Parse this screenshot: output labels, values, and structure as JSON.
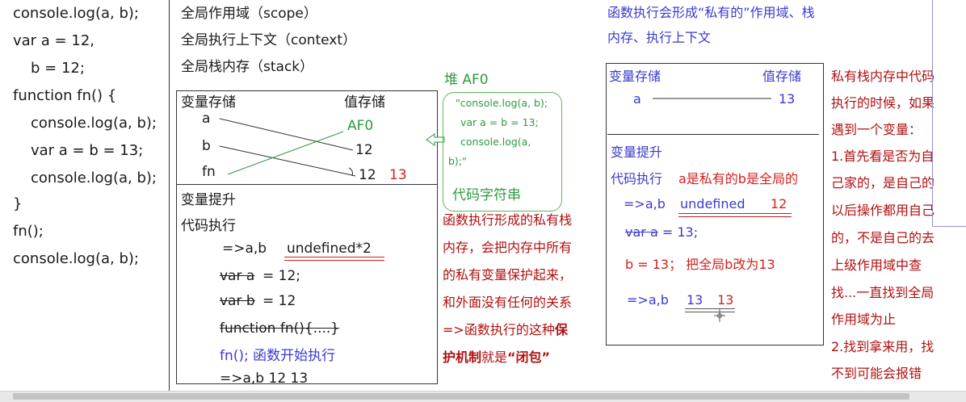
{
  "code": {
    "lines": [
      "console.log(a, b);",
      "var a = 12,",
      "b = 12;",
      "function fn() {",
      "console.log(a, b);",
      "var a = b = 13;",
      "console.log(a, b);",
      "}",
      "fn();",
      "console.log(a, b);"
    ]
  },
  "global": {
    "scope": "全局作用域（scope）",
    "context": "全局执行上下文（context）",
    "stack": "全局栈内存（stack）"
  },
  "global_box": {
    "var_store": "变量存储",
    "val_store": "值存储",
    "var_a": "a",
    "var_b": "b",
    "var_fn": "fn",
    "af0": "AF0",
    "val_12a": "12",
    "val_12b": "12",
    "val_13": "13",
    "hoist": "变量提升",
    "exec": "代码执行",
    "line1_arrow": "=>a,b",
    "line1_val": "undefined*2",
    "line2_kw": "var a",
    "line2_rest": "= 12;",
    "line3_kw": "var b",
    "line3_rest": "= 12",
    "line4": "function fn(){....}",
    "line5": "fn();  函数开始执行",
    "line6": "=>a,b   12  13"
  },
  "heap": {
    "title": "堆 AF0",
    "l1": "\"console.log(a, b);",
    "l2": "var a = b = 13;",
    "l3": "console.log(a,",
    "l4": "b);\"",
    "label": "代码字符串"
  },
  "closure": {
    "l1": "函数执行形成的私有栈",
    "l2": "内存，会把内存中所有",
    "l3": "的私有变量保护起来，",
    "l4": "和外面没有任何的关系",
    "l5_pre": "=>函数执行的这种",
    "l5_bold": "保",
    "l6_bold1": "护机制",
    "l6_mid": "就是",
    "l6_bold2": "“闭包”"
  },
  "fn_exec": {
    "l1": "函数执行会形成“私有的”作用域、栈",
    "l2": "内存、执行上下文"
  },
  "private_box": {
    "var_store": "变量存储",
    "val_store": "值存储",
    "var_a": "a",
    "val_13": "13",
    "hoist": "变量提升",
    "exec": "代码执行",
    "exec_note": "a是私有的b是全局的",
    "line1_arrow": "=>a,b",
    "line1_undef": "undefined",
    "line1_12": "12",
    "line2_kw": "var a",
    "line2_rest": "= 13;",
    "line3": "b = 13；  把全局b改为13",
    "line4_arrow": "=>a,b",
    "line4_v1": "13",
    "line4_v2": "13"
  },
  "notes": {
    "lines": [
      "私有栈内存中代码",
      "执行的时候，如果",
      "遇到一个变量：",
      "1.首先看是否为自",
      "己家的，是自己的",
      "以后操作都用自己",
      "的，不是自己的去",
      "上级作用域中查",
      "找...一直找到全局",
      "作用域为止",
      "2.找到拿来用，找",
      "不到可能会报错"
    ]
  },
  "colors": {
    "blue": "#3a3ad0",
    "green": "#2e9a3e",
    "red": "#d42020",
    "dark_red": "#b01010"
  }
}
